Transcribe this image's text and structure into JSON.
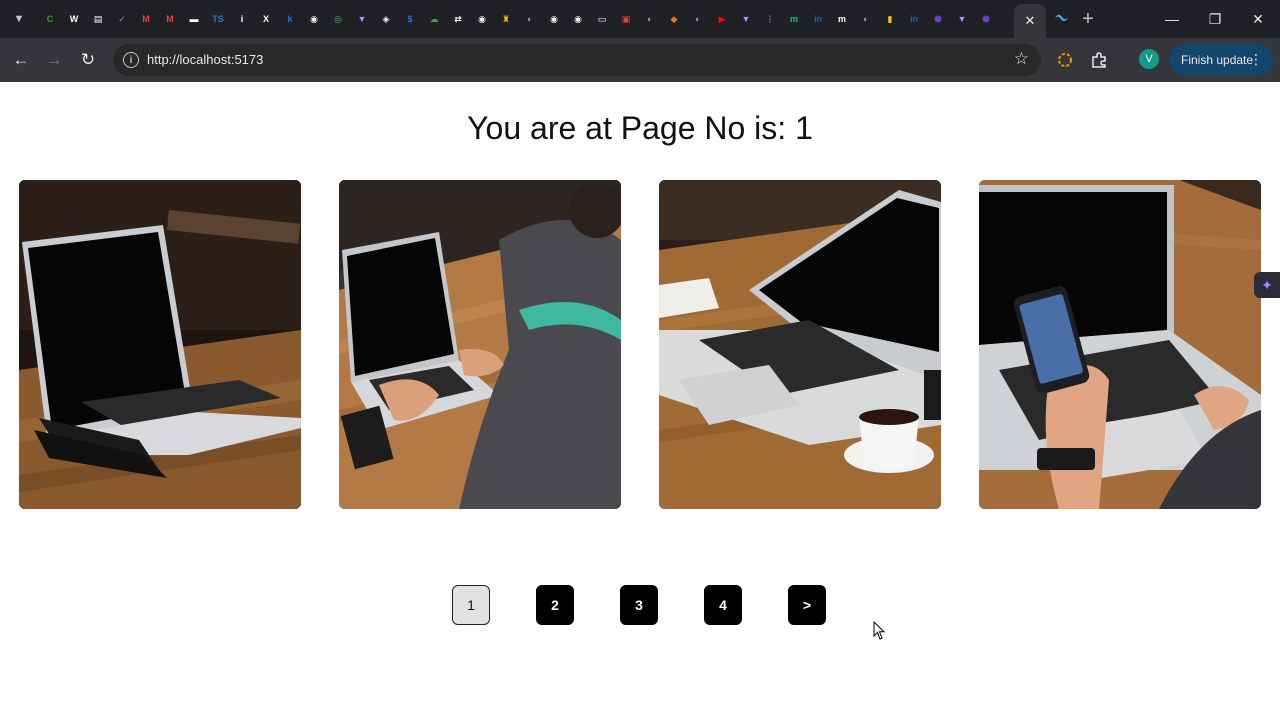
{
  "browser": {
    "url": "http://localhost:5173",
    "update_label": "Finish update",
    "profile_initial": "V",
    "pinned_tabs": [
      {
        "icon": "edge-c-icon",
        "glyph": "C",
        "color": "#2ea043"
      },
      {
        "icon": "w3-icon",
        "glyph": "W",
        "color": "#ffffff"
      },
      {
        "icon": "bookmark-grid-icon",
        "glyph": "▤",
        "color": "#ffffff"
      },
      {
        "icon": "vite-checklist-icon",
        "glyph": "✓",
        "color": "#a371f7"
      },
      {
        "icon": "gmail-icon",
        "glyph": "M",
        "color": "#ea4335"
      },
      {
        "icon": "gmail-icon",
        "glyph": "M",
        "color": "#ea4335"
      },
      {
        "icon": "news-icon",
        "glyph": "▬",
        "color": "#ffffff"
      },
      {
        "icon": "typescript-icon",
        "glyph": "TS",
        "color": "#3178c6"
      },
      {
        "icon": "info-icon",
        "glyph": "i",
        "color": "#ffffff"
      },
      {
        "icon": "x-icon",
        "glyph": "X",
        "color": "#ffffff"
      },
      {
        "icon": "bolt-icon",
        "glyph": "k",
        "color": "#1a73e8"
      },
      {
        "icon": "github-icon",
        "glyph": "◉",
        "color": "#ffffff"
      },
      {
        "icon": "whatsapp-icon",
        "glyph": "◎",
        "color": "#25d366"
      },
      {
        "icon": "vite-icon",
        "glyph": "▼",
        "color": "#a78bfa"
      },
      {
        "icon": "chatgpt-icon",
        "glyph": "◈",
        "color": "#ffffff"
      },
      {
        "icon": "dollar-icon",
        "glyph": "$",
        "color": "#1a73e8"
      },
      {
        "icon": "cloud-icon",
        "glyph": "☁",
        "color": "#34a853"
      },
      {
        "icon": "arrows-icon",
        "glyph": "⇄",
        "color": "#ffffff"
      },
      {
        "icon": "github-icon",
        "glyph": "◉",
        "color": "#ffffff"
      },
      {
        "icon": "trophy-icon",
        "glyph": "♜",
        "color": "#fbbc04"
      },
      {
        "icon": "globe-icon",
        "glyph": "◐",
        "color": "#9aa0a6"
      },
      {
        "icon": "github-icon",
        "glyph": "◉",
        "color": "#ffffff"
      },
      {
        "icon": "github-icon",
        "glyph": "◉",
        "color": "#ffffff"
      },
      {
        "icon": "document-icon",
        "glyph": "▭",
        "color": "#ffffff"
      },
      {
        "icon": "pdf-icon",
        "glyph": "▣",
        "color": "#ea4335"
      },
      {
        "icon": "globe-icon",
        "glyph": "◐",
        "color": "#9aa0a6"
      },
      {
        "icon": "fire-icon",
        "glyph": "◆",
        "color": "#f57c00"
      },
      {
        "icon": "globe-icon",
        "glyph": "◐",
        "color": "#9aa0a6"
      },
      {
        "icon": "youtube-icon",
        "glyph": "▶",
        "color": "#ff0000"
      },
      {
        "icon": "vite-icon",
        "glyph": "▼",
        "color": "#a78bfa"
      },
      {
        "icon": "divider-icon",
        "glyph": "⋮",
        "color": "#5f6368"
      },
      {
        "icon": "meet-icon",
        "glyph": "m",
        "color": "#00bfa5"
      },
      {
        "icon": "linkedin-icon",
        "glyph": "in",
        "color": "#0a66c2"
      },
      {
        "icon": "dev-icon",
        "glyph": "m",
        "color": "#ffffff"
      },
      {
        "icon": "globe-icon",
        "glyph": "◐",
        "color": "#9aa0a6"
      },
      {
        "icon": "bookmark-icon",
        "glyph": "▮",
        "color": "#fbbc04"
      },
      {
        "icon": "linkedin-icon",
        "glyph": "in",
        "color": "#0a66c2"
      },
      {
        "icon": "hex-icon",
        "glyph": "⬢",
        "color": "#6e40c9"
      },
      {
        "icon": "vite-icon",
        "glyph": "▼",
        "color": "#a78bfa"
      },
      {
        "icon": "hex-icon",
        "glyph": "⬢",
        "color": "#6e40c9"
      }
    ]
  },
  "page": {
    "title": "You are at Page No is: 1",
    "current_page": 1,
    "cards": [
      {
        "scene": "laptop-on-wooden-table-with-notebook"
      },
      {
        "scene": "man-typing-on-laptop"
      },
      {
        "scene": "laptop-with-coffee-cup"
      },
      {
        "scene": "hands-holding-phone-over-laptop"
      }
    ],
    "pagination": [
      "1",
      "2",
      "3",
      "4",
      ">"
    ]
  },
  "colors": {
    "chrome_bg": "#202124",
    "toolbar_bg": "#35363a",
    "pager_bg": "#000000",
    "pager_active_bg": "#e2e2e2"
  }
}
